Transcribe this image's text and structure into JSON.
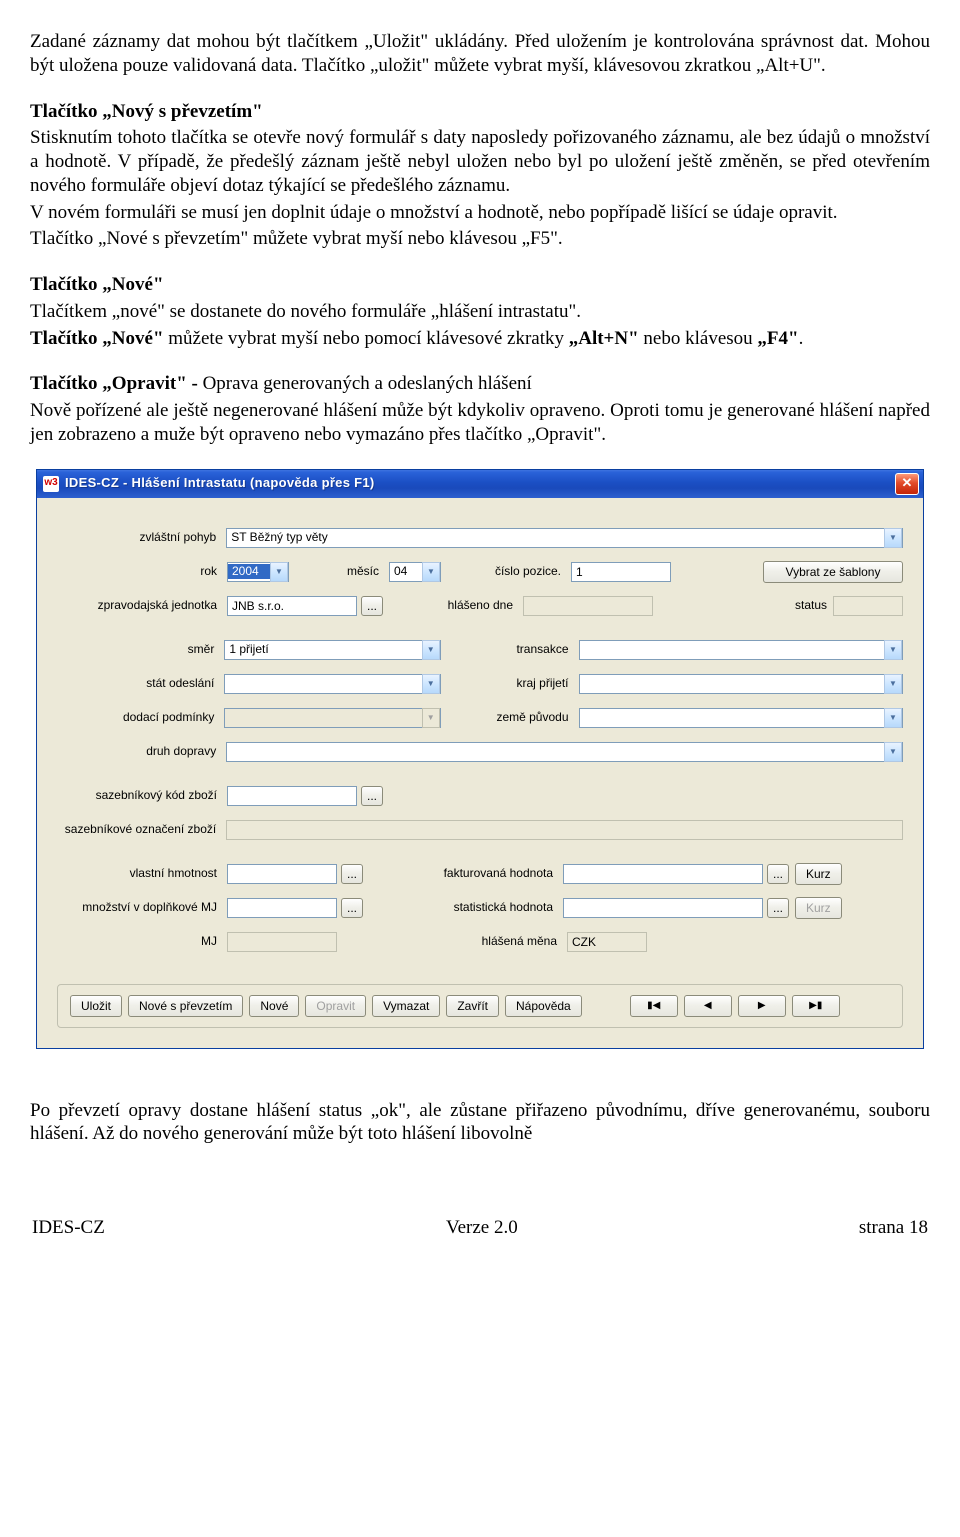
{
  "doc": {
    "p1": "Zadané záznamy dat mohou být tlačítkem „Uložit\" ukládány. Před uložením je kontrolována správnost dat. Mohou být uložena pouze validovaná data. Tlačítko „uložit\" můžete vybrat myší, klávesovou zkratkou „Alt+U\".",
    "h2": "Tlačítko „Nový s převzetím\"",
    "p2": "Stisknutím tohoto tlačítka se otevře nový formulář s daty naposledy pořizovaného záznamu, ale bez údajů o množství a hodnotě. V případě, že předešlý záznam ještě nebyl uložen nebo byl po uložení ještě změněn, se před otevřením nového formuláře objeví dotaz týkající se předešlého záznamu.",
    "p3": "V novém formuláři se musí jen doplnit údaje o množství a hodnotě, nebo popřípadě lišící se údaje opravit.",
    "p4": "Tlačítko „Nové s převzetím\" můžete vybrat myší nebo klávesou „F5\".",
    "h3": "Tlačítko „Nové\"",
    "p5": "Tlačítkem „nové\" se dostanete do nového formuláře „hlášení intrastatu\".",
    "p6_a": "Tlačítko „Nové\"",
    "p6_b": " můžete vybrat myší nebo pomocí klávesové zkratky ",
    "p6_c": "„Alt+N\"",
    "p6_d": " nebo klávesou ",
    "p6_e": "„F4\"",
    "p6_f": ".",
    "h4_a": "Tlačítko „Opravit\" - ",
    "h4_b": "Oprava generovaných a odeslaných hlášení",
    "p7": "Nově pořízené ale ještě negenerované hlášení může být kdykoliv opraveno. Oproti tomu je generované hlášení napřed jen zobrazeno a muže být opraveno nebo vymazáno přes tlačítko „Opravit\".",
    "p8": "Po převzetí opravy dostane hlášení status „ok\", ale zůstane přiřazeno původnímu, dříve generovanému, souboru hlášení. Až do nového generování může být toto hlášení libovolně"
  },
  "app": {
    "icon_text": "w3",
    "title": "IDES-CZ - Hlášení Intrastatu      (napověda přes F1)",
    "labels": {
      "zvlastni_pohyb": "zvláštní pohyb",
      "rok": "rok",
      "mesic": "měsíc",
      "cislo_pozice": "číslo pozice.",
      "zpravodajska_jednotka": "zpravodajská jednotka",
      "hlaseno_dne": "hlášeno dne",
      "status": "status",
      "smer": "směr",
      "transakce": "transakce",
      "stat_odeslani": "stát odeslání",
      "kraj_prijeti": "kraj přijetí",
      "dodaci_podminky": "dodací podmínky",
      "zeme_puvodu": "země původu",
      "druh_dopravy": "druh dopravy",
      "sazebnikovy_kod": "sazebníkový kód zboží",
      "sazebnikove_oznaceni": "sazebníkové označení zboží",
      "vlastni_hmotnost": "vlastní hmotnost",
      "fakturovana_hodnota": "fakturovaná hodnota",
      "mnozstvi_mj": "množství v doplňkové MJ",
      "statisticka_hodnota": "statistická hodnota",
      "mj": "MJ",
      "hlasena_mena": "hlášená měna"
    },
    "values": {
      "zvlastni_pohyb": "ST Běžný typ věty",
      "rok": "2004",
      "mesic": "04",
      "cislo_pozice": "1",
      "zpravodajska_jednotka": "JNB s.r.o.",
      "smer": "1 přijetí",
      "hlasena_mena": "CZK"
    },
    "buttons": {
      "vybrat_sablony": "Vybrat ze šablony",
      "kurz": "Kurz",
      "ulozit": "Uložit",
      "nove_prevzetim": "Nové s převzetím",
      "nove": "Nové",
      "opravit": "Opravit",
      "vymazat": "Vymazat",
      "zavrit": "Zavřít",
      "napoveda": "Nápověda",
      "ellipsis": "..."
    }
  },
  "footer": {
    "left": "IDES-CZ",
    "center": "Verze 2.0",
    "right": "strana 18"
  }
}
